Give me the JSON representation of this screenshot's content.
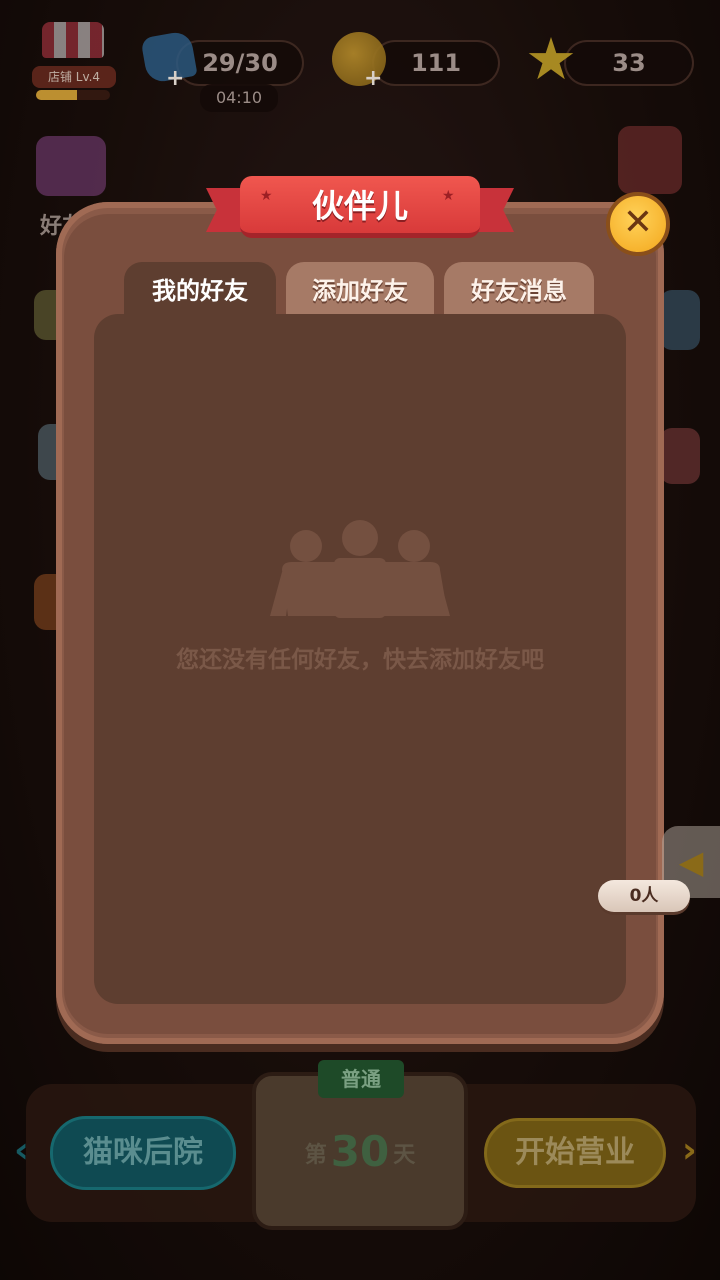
{
  "hud": {
    "shop_level": "店铺 Lv.4",
    "shop_level_progress": 0.55,
    "energy": "29/30",
    "energy_timer": "04:10",
    "coins": "111",
    "stars": "33"
  },
  "side_menu": {
    "friends_label": "好友"
  },
  "modal": {
    "title": "伙伴儿",
    "tabs": [
      {
        "label": "我的好友",
        "active": true
      },
      {
        "label": "添加好友",
        "active": false
      },
      {
        "label": "好友消息",
        "active": false
      }
    ],
    "empty_message": "您还没有任何好友，快去添加好友吧",
    "friend_count": "0人",
    "close_icon": "close-icon"
  },
  "bottom": {
    "cat_button": "猫咪后院",
    "mode_tag": "普通",
    "day_prefix": "第",
    "day_number": "30",
    "day_suffix": "天",
    "start_button": "开始营业"
  },
  "colors": {
    "ribbon": "#e0443f",
    "close_button": "#f5b02a",
    "modal_frame": "#8a5a48",
    "panel": "#5e3e30",
    "tab_inactive": "#a67a66"
  }
}
